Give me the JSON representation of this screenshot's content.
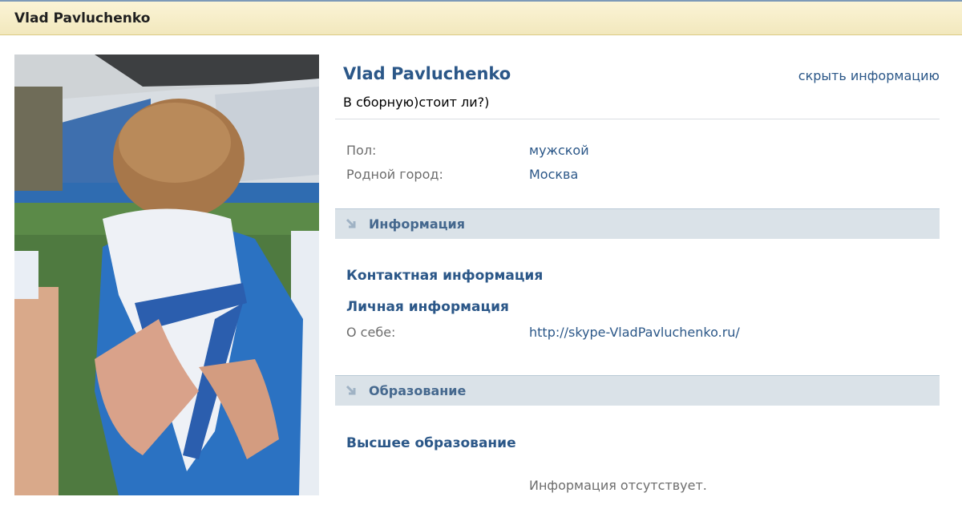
{
  "header": {
    "title": "Vlad Pavluchenko"
  },
  "profile": {
    "name": "Vlad Pavluchenko",
    "hide_link": "скрыть информацию",
    "status": "В сборную)стоит ли?)",
    "photo_icon": "profile-photo"
  },
  "basic": {
    "rows": [
      {
        "label": "Пол:",
        "value": "мужской"
      },
      {
        "label": "Родной город:",
        "value": "Москва"
      }
    ]
  },
  "sections": {
    "info": {
      "title": "Информация",
      "icon": "arrow-down-right-icon",
      "contact_heading": "Контактная информация",
      "personal_heading": "Личная информация",
      "about_label": "О себе:",
      "about_value": "http://skype-VladPavluchenko.ru/"
    },
    "education": {
      "title": "Образование",
      "icon": "arrow-down-right-icon",
      "higher_heading": "Высшее образование",
      "empty_note": "Информация отсутствует."
    }
  },
  "colors": {
    "link": "#2b5788",
    "section_bg": "#dae2e8",
    "header_bg": "#f7efcc"
  }
}
